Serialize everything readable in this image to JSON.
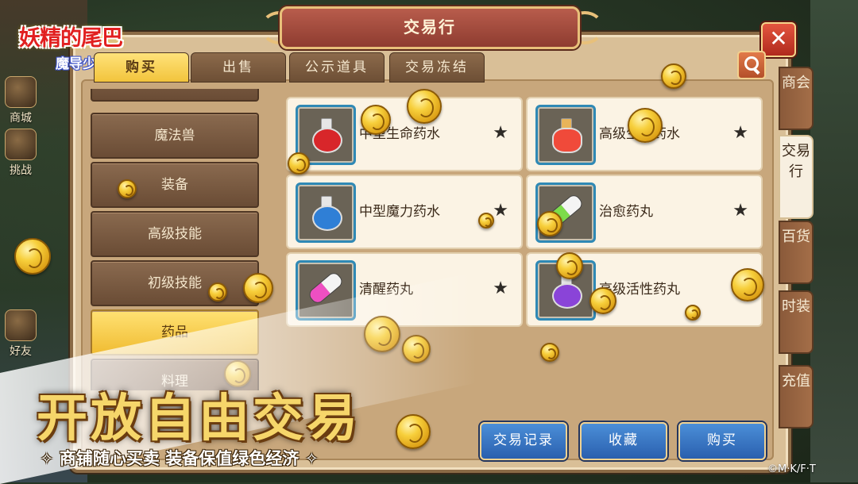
{
  "logo": {
    "line1": "妖精的尾巴",
    "line2": "魔导少年"
  },
  "window": {
    "title": "交易行"
  },
  "tabs": [
    {
      "label": "购买",
      "active": true
    },
    {
      "label": "出售",
      "active": false
    },
    {
      "label": "公示道具",
      "active": false
    },
    {
      "label": "交易冻结",
      "active": false
    }
  ],
  "categories": [
    {
      "label": "魔法兽",
      "active": false
    },
    {
      "label": "装备",
      "active": false
    },
    {
      "label": "高级技能",
      "active": false
    },
    {
      "label": "初级技能",
      "active": false
    },
    {
      "label": "药品",
      "active": true
    },
    {
      "label": "料理",
      "active": false
    }
  ],
  "items": [
    {
      "name": "中型生命药水",
      "favorite": true,
      "icon": "red-potion-icon"
    },
    {
      "name": "高级生命药水",
      "favorite": true,
      "icon": "heart-potion-icon"
    },
    {
      "name": "中型魔力药水",
      "favorite": true,
      "icon": "blue-potion-icon"
    },
    {
      "name": "治愈药丸",
      "favorite": true,
      "icon": "green-pill-icon"
    },
    {
      "name": "清醒药丸",
      "favorite": true,
      "icon": "pink-pill-icon"
    },
    {
      "name": "高级活性药丸",
      "favorite": false,
      "icon": "purple-potion-icon"
    }
  ],
  "star_glyph": "★",
  "buttons": {
    "history": "交易记录",
    "favorites": "收藏",
    "buy": "购买"
  },
  "side_tabs": [
    {
      "label": "商会",
      "active": false
    },
    {
      "label": "交易行",
      "active": true
    },
    {
      "label": "百货",
      "active": false
    },
    {
      "label": "时装",
      "active": false
    },
    {
      "label": "充值",
      "active": false
    }
  ],
  "left_icons": [
    {
      "label": "商城"
    },
    {
      "label": "挑战"
    },
    {
      "label": "好友"
    }
  ],
  "promo": {
    "title": "开放自由交易",
    "subtitle": "✧ 商铺随心买卖  装备保值绿色经济 ✧"
  },
  "copyright": "©M·K/F·T",
  "colors": {
    "accent_gold": "#f2c43c",
    "button_blue": "#2a5fae",
    "title_red": "#8e3c30"
  }
}
